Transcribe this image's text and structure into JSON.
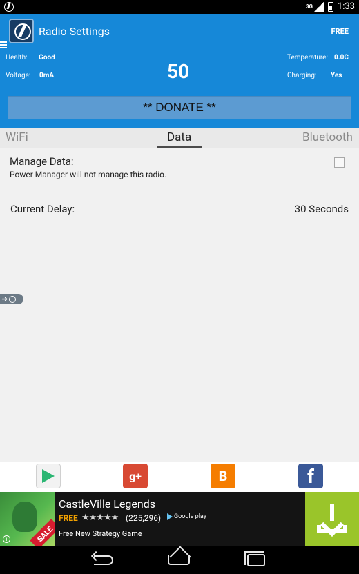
{
  "status_bar": {
    "network": "3G",
    "time": "1:33"
  },
  "header": {
    "title": "Radio Settings",
    "free_label": "FREE",
    "health_label": "Health:",
    "health_value": "Good",
    "voltage_label": "Voltage:",
    "voltage_value": "0mA",
    "battery_level": "50",
    "temperature_label": "Temperature:",
    "temperature_value": "0.0C",
    "charging_label": "Charging:",
    "charging_value": "Yes",
    "donate_label": "** DONATE **"
  },
  "tabs": [
    {
      "label": "WiFi",
      "active": false
    },
    {
      "label": "Data",
      "active": true
    },
    {
      "label": "Bluetooth",
      "active": false
    }
  ],
  "settings": {
    "manage_data_label": "Manage Data:",
    "manage_data_desc": "Power Manager will not manage this radio.",
    "manage_data_checked": false,
    "current_delay_label": "Current Delay:",
    "current_delay_value": "30 Seconds"
  },
  "social": [
    {
      "name": "Google Play",
      "icon": "play-store-icon"
    },
    {
      "name": "Google+",
      "icon": "google-plus-icon",
      "text": "g+"
    },
    {
      "name": "Blogger",
      "icon": "blogger-icon",
      "text": "B"
    },
    {
      "name": "Facebook",
      "icon": "facebook-icon",
      "text": "f"
    }
  ],
  "ad": {
    "title": "CastleVille Legends",
    "price": "FREE",
    "stars": "★★★★★",
    "rating_count": "(225,296)",
    "store": "Google play",
    "subtitle": "Free New Strategy Game",
    "sale_label": "SALE"
  },
  "colors": {
    "accent_blue": "#1688d8",
    "donate_blue": "#5c9bd2",
    "download_green": "#9ac52a",
    "ad_background": "#141414"
  }
}
